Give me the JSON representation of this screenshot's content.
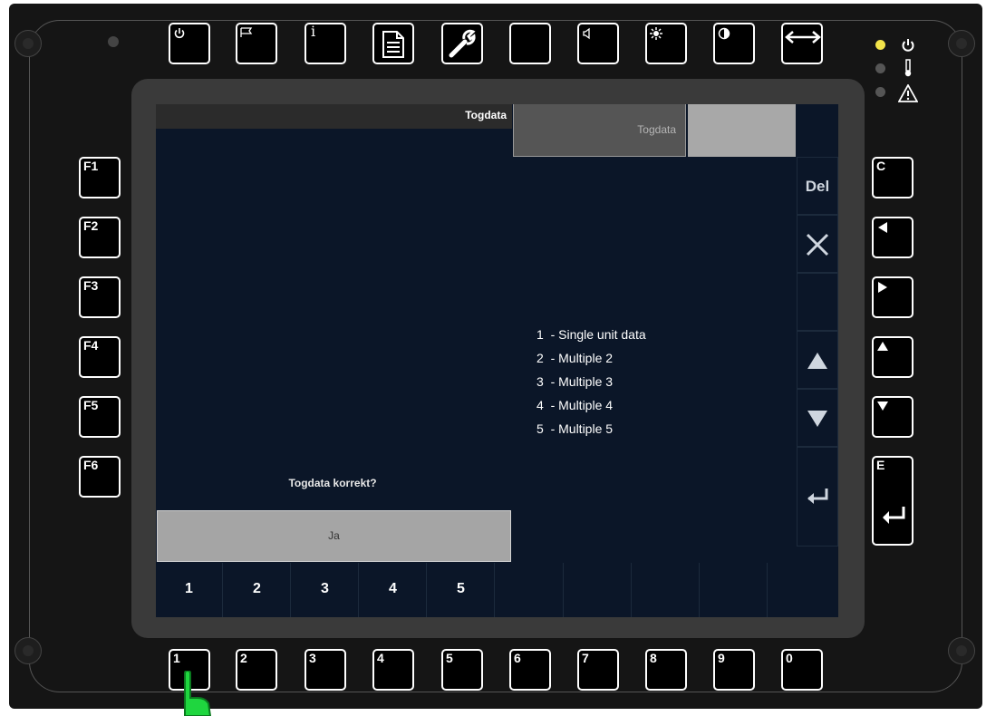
{
  "colors": {
    "screen_bg": "#0b1628",
    "led_power": "#f2e34a",
    "finger": "#1fd63f"
  },
  "top_buttons": [
    {
      "icon": "power-icon"
    },
    {
      "icon": "flag-icon"
    },
    {
      "icon": "info-icon",
      "label": "i"
    },
    {
      "icon": "document-icon"
    },
    {
      "icon": "wrench-icon"
    },
    {
      "icon": "blank"
    },
    {
      "icon": "speaker-icon"
    },
    {
      "icon": "brightness-icon"
    },
    {
      "icon": "contrast-icon"
    },
    {
      "icon": "swap-horizontal-icon"
    }
  ],
  "left_buttons": [
    "F1",
    "F2",
    "F3",
    "F4",
    "F5",
    "F6"
  ],
  "right_buttons": [
    {
      "label": "C",
      "icon": ""
    },
    {
      "label": "",
      "icon": "arrow-left-icon"
    },
    {
      "label": "",
      "icon": "arrow-right-icon"
    },
    {
      "label": "",
      "icon": "arrow-up-icon"
    },
    {
      "label": "",
      "icon": "arrow-down-icon"
    },
    {
      "label": "E",
      "icon": "enter-icon"
    }
  ],
  "bottom_buttons": [
    "1",
    "2",
    "3",
    "4",
    "5",
    "6",
    "7",
    "8",
    "9",
    "0"
  ],
  "screen": {
    "title": "Togdata",
    "tab_label": "Togdata",
    "options": [
      "1  - Single unit data",
      "2  - Multiple 2",
      "3  - Multiple 3",
      "4  - Multiple 4",
      "5  - Multiple 5"
    ],
    "question": "Togdata korrekt?",
    "ja_label": "Ja",
    "side": {
      "del_label": "Del"
    },
    "number_row": [
      "1",
      "2",
      "3",
      "4",
      "5",
      "",
      "",
      "",
      "",
      ""
    ]
  }
}
